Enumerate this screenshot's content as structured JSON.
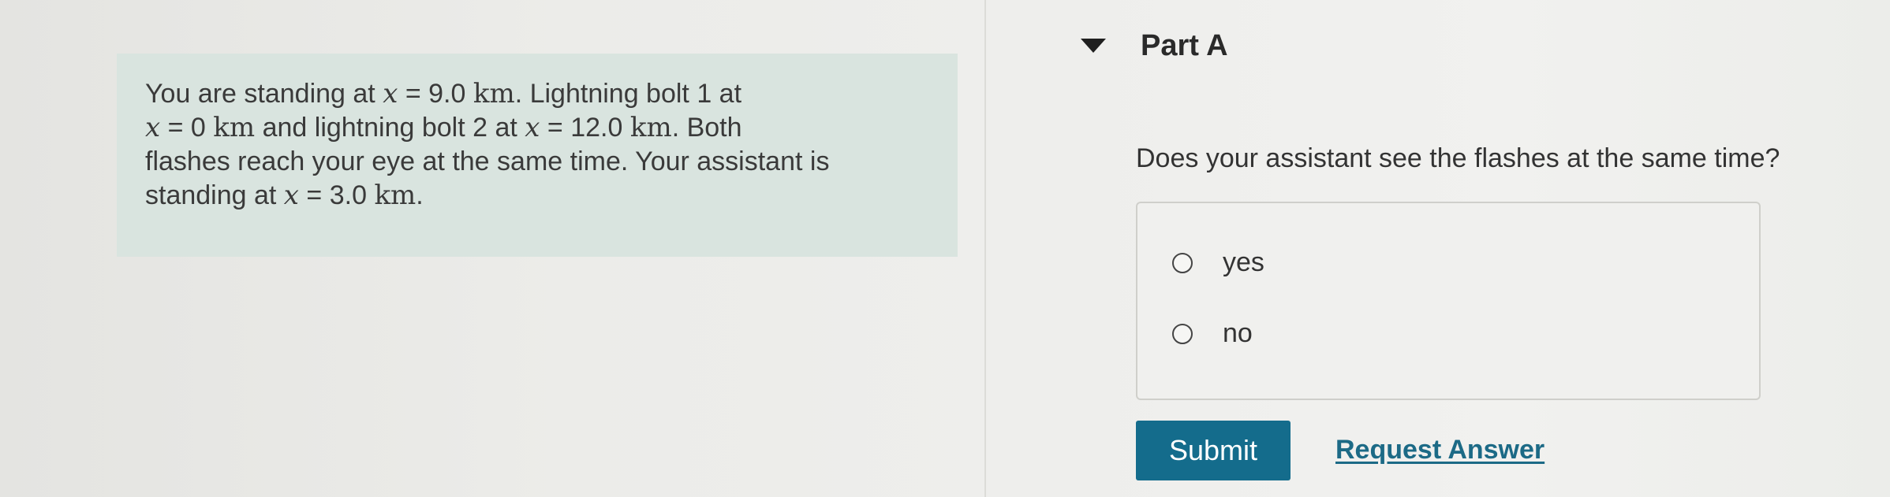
{
  "problem": {
    "line1_a": "You are standing at ",
    "line1_var": "x",
    "line1_eq": " = 9.0 ",
    "line1_unit": "km",
    "line1_b": ". Lightning bolt 1 at",
    "line2_var": "x",
    "line2_eq": " = 0 ",
    "line2_unit": "km",
    "line2_a": " and lightning bolt 2 at ",
    "line2_var2": "x",
    "line2_eq2": " = 12.0 ",
    "line2_unit2": "km",
    "line2_b": ". Both",
    "line3": "flashes reach your eye at the same time. Your assistant is",
    "line4_a": "standing at ",
    "line4_var": "x",
    "line4_eq": " = 3.0 ",
    "line4_unit": "km",
    "line4_b": "."
  },
  "part": {
    "title": "Part A",
    "toggle_icon": "caret-down-icon"
  },
  "question": {
    "text": "Does your assistant see the flashes at the same time?"
  },
  "options": [
    {
      "label": "yes",
      "selected": false
    },
    {
      "label": "no",
      "selected": false
    }
  ],
  "actions": {
    "submit_label": "Submit",
    "request_answer_label": "Request Answer"
  },
  "colors": {
    "problem_background": "#d9e4df",
    "submit_background": "#146c8c",
    "link": "#1c6a86"
  }
}
